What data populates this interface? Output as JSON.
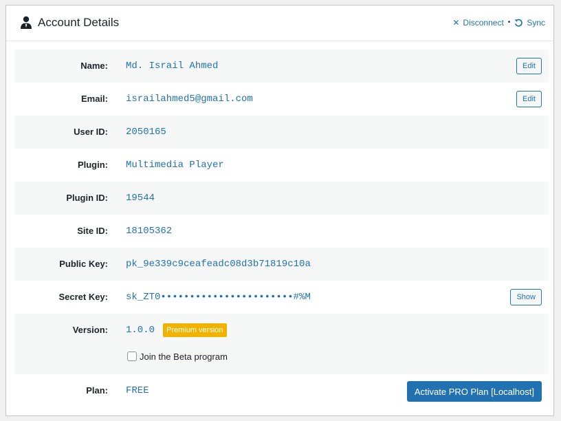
{
  "header": {
    "title": "Account Details",
    "disconnect_label": "Disconnect",
    "separator": "•",
    "sync_label": "Sync",
    "icons": {
      "title": "user-icon",
      "disconnect": "x-icon",
      "sync": "sync-icon"
    }
  },
  "rows": {
    "name": {
      "label": "Name:",
      "value": "Md. Israil Ahmed",
      "button": "Edit"
    },
    "email": {
      "label": "Email:",
      "value": "israilahmed5@gmail.com",
      "button": "Edit"
    },
    "user_id": {
      "label": "User ID:",
      "value": "2050165"
    },
    "plugin": {
      "label": "Plugin:",
      "value": "Multimedia Player"
    },
    "plugin_id": {
      "label": "Plugin ID:",
      "value": "19544"
    },
    "site_id": {
      "label": "Site ID:",
      "value": "18105362"
    },
    "public_key": {
      "label": "Public Key:",
      "value": "pk_9e339c9ceafeadc08d3b71819c10a"
    },
    "secret_key": {
      "label": "Secret Key:",
      "value": "sk_ZT0•••••••••••••••••••••••#%M",
      "button": "Show"
    },
    "version": {
      "label": "Version:",
      "value": "1.0.0",
      "badge": "Premium version",
      "beta_label": "Join the Beta program",
      "beta_checked": false
    },
    "plan": {
      "label": "Plan:",
      "value": "FREE",
      "button": "Activate PRO Plan [Localhost]"
    }
  },
  "colors": {
    "accent": "#2271b1",
    "badge": "#f0b400",
    "alt_row": "#f6f7f7"
  }
}
